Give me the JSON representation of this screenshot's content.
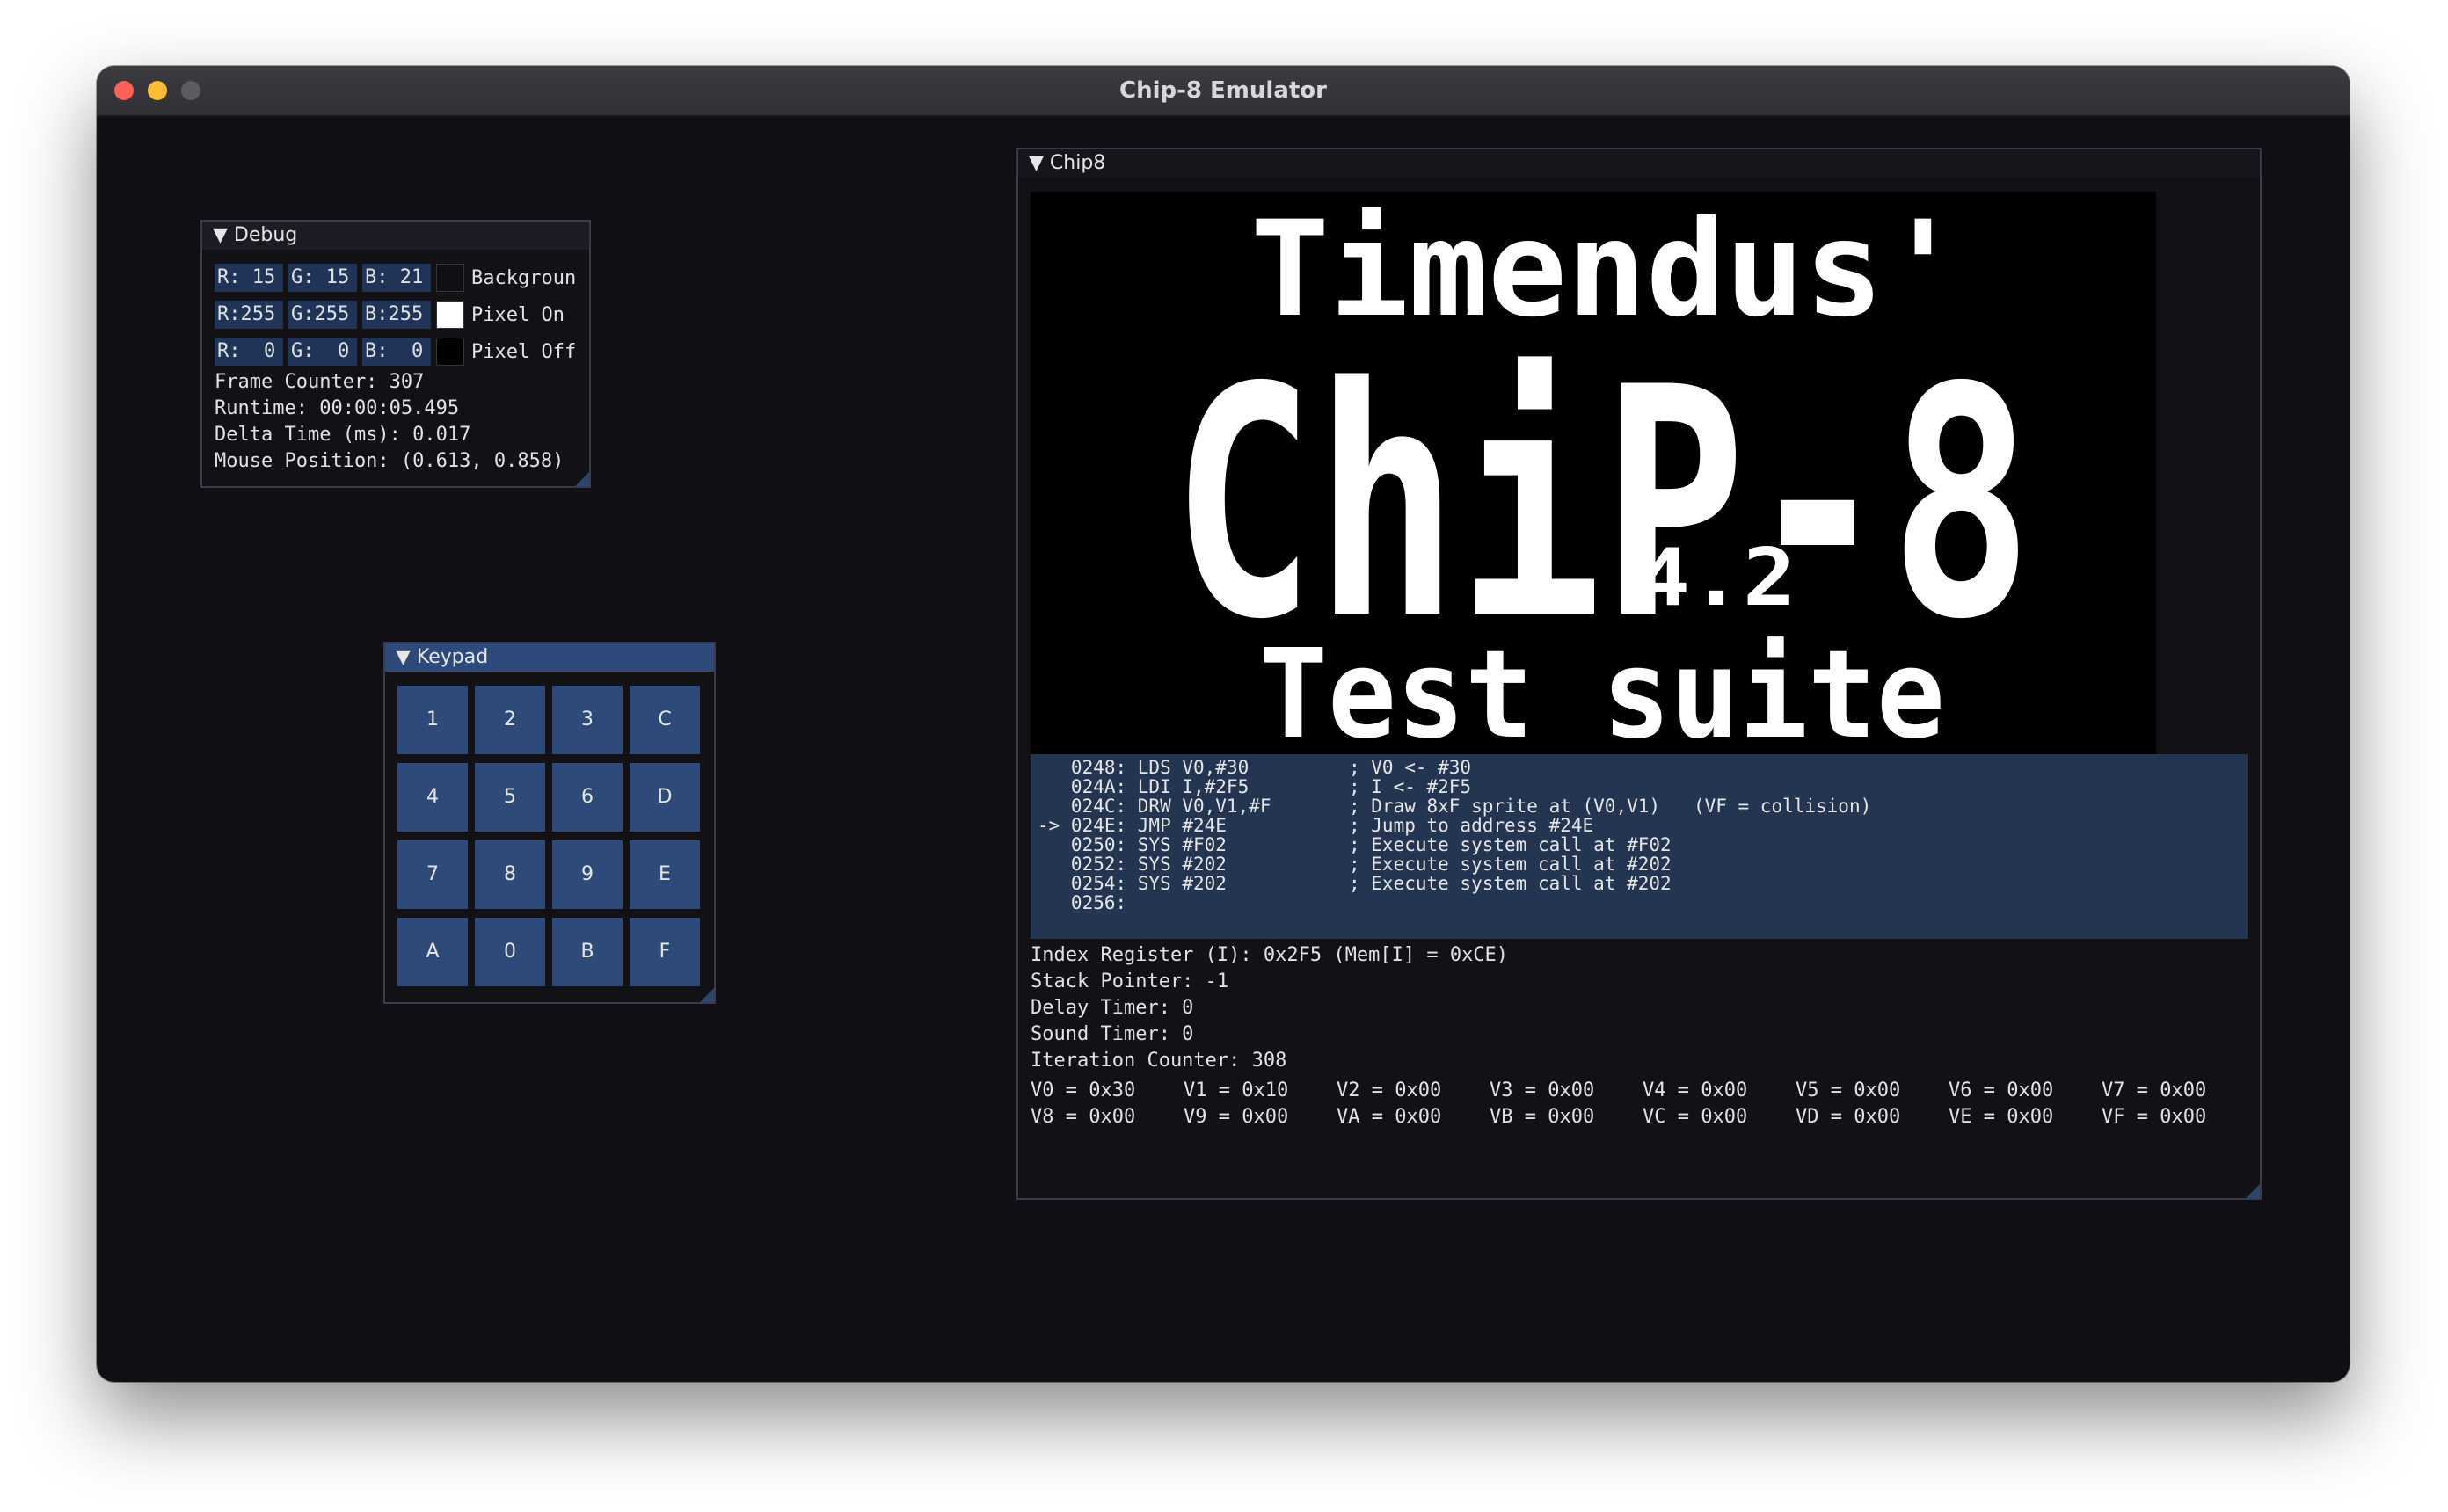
{
  "window": {
    "title": "Chip-8 Emulator"
  },
  "debug": {
    "header": "▼ Debug",
    "rows": [
      {
        "r": "R: 15",
        "g": "G: 15",
        "b": "B: 21",
        "swatch": "#0f0f15",
        "label": "Backgroun"
      },
      {
        "r": "R:255",
        "g": "G:255",
        "b": "B:255",
        "swatch": "#ffffff",
        "label": "Pixel On"
      },
      {
        "r": "R:  0",
        "g": "G:  0",
        "b": "B:  0",
        "swatch": "#000000",
        "label": "Pixel Off"
      }
    ],
    "frame_counter": "Frame Counter: 307",
    "runtime": "Runtime: 00:00:05.495",
    "delta_time": "Delta Time (ms): 0.017",
    "mouse_position": "Mouse Position: (0.613, 0.858)"
  },
  "keypad": {
    "header": "▼ Keypad",
    "keys": [
      "1",
      "2",
      "3",
      "C",
      "4",
      "5",
      "6",
      "D",
      "7",
      "8",
      "9",
      "E",
      "A",
      "0",
      "B",
      "F"
    ]
  },
  "chip8": {
    "header": "▼ Chip8",
    "screen_line1": "Timendus'",
    "screen_line2": "ChiP-8",
    "screen_version": "4.2",
    "screen_line3": "Test suite",
    "disassembly": [
      "   0248: LDS V0,#30         ; V0 <- #30",
      "   024A: LDI I,#2F5         ; I <- #2F5",
      "   024C: DRW V0,V1,#F       ; Draw 8xF sprite at (V0,V1)   (VF = collision)",
      "-> 024E: JMP #24E           ; Jump to address #24E",
      "   0250: SYS #F02           ; Execute system call at #F02",
      "   0252: SYS #202           ; Execute system call at #202",
      "   0254: SYS #202           ; Execute system call at #202",
      "   0256:"
    ],
    "index_register": "Index Register (I): 0x2F5 (Mem[I] = 0xCE)",
    "stack_pointer": "Stack Pointer: -1",
    "delay_timer": "Delay Timer: 0",
    "sound_timer": "Sound Timer: 0",
    "iteration_counter": "Iteration Counter: 308",
    "registers": [
      "V0 = 0x30",
      "V1 = 0x10",
      "V2 = 0x00",
      "V3 = 0x00",
      "V4 = 0x00",
      "V5 = 0x00",
      "V6 = 0x00",
      "V7 = 0x00",
      "V8 = 0x00",
      "V9 = 0x00",
      "VA = 0x00",
      "VB = 0x00",
      "VC = 0x00",
      "VD = 0x00",
      "VE = 0x00",
      "VF = 0x00"
    ]
  },
  "colors": {
    "accent": "#2e4a7a",
    "background": "#0f0f15",
    "disassembly_bg": "#243552"
  }
}
